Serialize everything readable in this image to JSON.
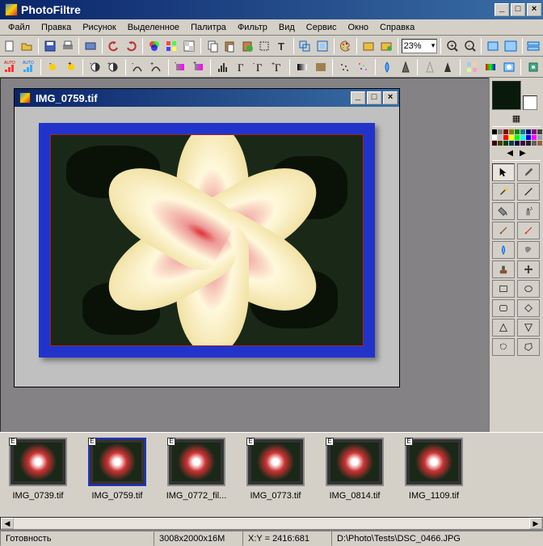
{
  "app": {
    "title": "PhotoFiltre"
  },
  "menu": [
    "Файл",
    "Правка",
    "Рисунок",
    "Выделенное",
    "Палитра",
    "Фильтр",
    "Вид",
    "Сервис",
    "Окно",
    "Справка"
  ],
  "toolbar1": {
    "zoom": "23%"
  },
  "document": {
    "title": "IMG_0759.tif"
  },
  "swatch_colors": [
    "#000000",
    "#808080",
    "#800000",
    "#808000",
    "#008000",
    "#008080",
    "#000080",
    "#800080",
    "#404040",
    "#ffffff",
    "#c0c0c0",
    "#ff0000",
    "#ffff00",
    "#00ff00",
    "#00ffff",
    "#0000ff",
    "#ff00ff",
    "#a0a0a0",
    "#400000",
    "#404000",
    "#004000",
    "#004040",
    "#000040",
    "#400040",
    "#202020",
    "#606060",
    "#a06040"
  ],
  "thumbnails": [
    {
      "label": "IMG_0739.tif"
    },
    {
      "label": "IMG_0759.tif",
      "selected": true
    },
    {
      "label": "IMG_0772_fil..."
    },
    {
      "label": "IMG_0773.tif"
    },
    {
      "label": "IMG_0814.tif"
    },
    {
      "label": "IMG_1109.tif"
    }
  ],
  "status": {
    "ready": "Готовность",
    "dims": "3008x2000x16M",
    "coords": "X:Y = 2416:681",
    "path": "D:\\Photo\\Tests\\DSC_0466.JPG"
  }
}
